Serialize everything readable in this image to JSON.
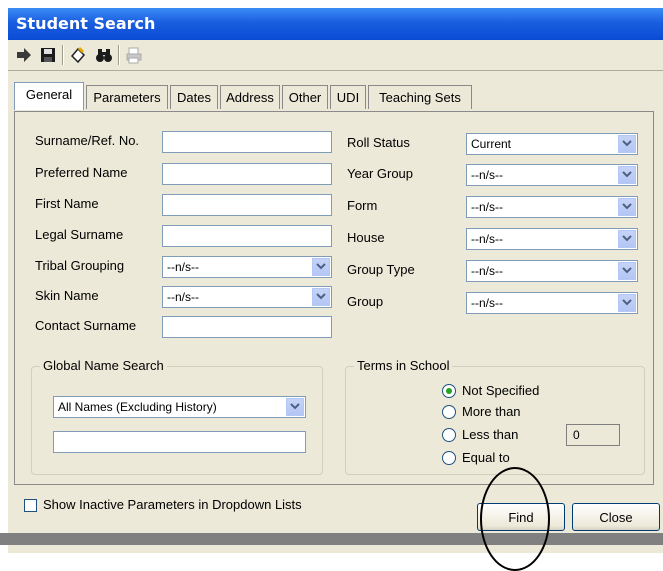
{
  "window": {
    "title": "Student Search"
  },
  "toolbar": {
    "icons": [
      "forward-icon",
      "save-icon",
      "clear-icon",
      "binoculars-icon",
      "print-icon"
    ]
  },
  "tabs": [
    {
      "label": "General",
      "active": true
    },
    {
      "label": "Parameters"
    },
    {
      "label": "Dates"
    },
    {
      "label": "Address"
    },
    {
      "label": "Other"
    },
    {
      "label": "UDI"
    },
    {
      "label": "Teaching Sets"
    }
  ],
  "left_fields": {
    "surname_label": "Surname/Ref. No.",
    "preferred_label": "Preferred Name",
    "first_label": "First Name",
    "legal_label": "Legal Surname",
    "tribal_label": "Tribal Grouping",
    "tribal_value": "--n/s--",
    "skin_label": "Skin Name",
    "skin_value": "--n/s--",
    "contact_label": "Contact Surname"
  },
  "right_fields": {
    "roll_label": "Roll Status",
    "roll_value": "Current",
    "year_label": "Year Group",
    "year_value": "--n/s--",
    "form_label": "Form",
    "form_value": "--n/s--",
    "house_label": "House",
    "house_value": "--n/s--",
    "grouptype_label": "Group Type",
    "grouptype_value": "--n/s--",
    "group_label": "Group",
    "group_value": "--n/s--"
  },
  "global_search": {
    "title": "Global Name Search",
    "mode_value": "All Names (Excluding History)"
  },
  "terms": {
    "title": "Terms in School",
    "options": [
      "Not Specified",
      "More than",
      "Less than",
      "Equal to"
    ],
    "selected": "Not Specified",
    "count_value": "0"
  },
  "footer": {
    "show_inactive_label": "Show Inactive Parameters in Dropdown Lists",
    "find_label": "Find",
    "close_label": "Close"
  }
}
